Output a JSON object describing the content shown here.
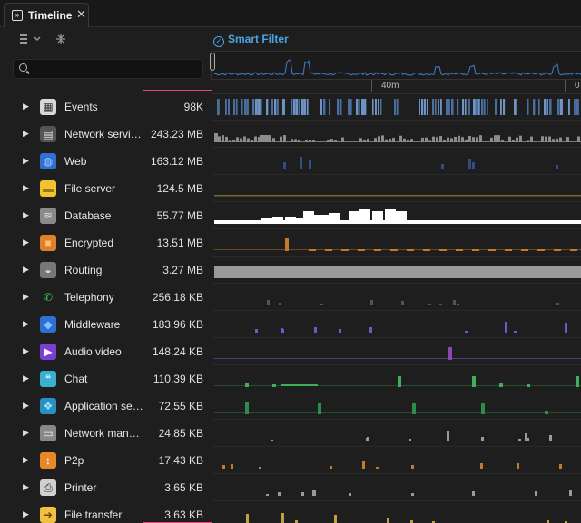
{
  "tab": {
    "title": "Timeline",
    "close_glyph": "✕",
    "icon_glyph": "»"
  },
  "toolbar": {
    "smart_filter_label": "Smart Filter",
    "list_options_icon": "list-view-icon",
    "collapse_icon": "collapse-rows-icon"
  },
  "search": {
    "placeholder": "",
    "value": ""
  },
  "overview": {
    "accent": "#3e7fd0",
    "ticks": [
      "40m",
      "0"
    ]
  },
  "colors": {
    "highlight": "#e0457b",
    "accent": "#4da3e0"
  },
  "rows": [
    {
      "label": "Events",
      "size": "98K",
      "icon": "calendar-icon",
      "glyph": "▦",
      "icon_bg": "#d8d8d8",
      "icon_fg": "#333",
      "track_color": "#4a6f9e",
      "track": "dense"
    },
    {
      "label": "Network services",
      "size": "243.23 MB",
      "icon": "network-services-icon",
      "glyph": "▤",
      "icon_bg": "#555",
      "icon_fg": "#ddd",
      "track_color": "#8c8c8c",
      "track": "gray"
    },
    {
      "label": "Web",
      "size": "163.12 MB",
      "icon": "globe-icon",
      "glyph": "◍",
      "icon_bg": "#2f6fd6",
      "icon_fg": "#9fd1ff",
      "track_color": "#2f4e86",
      "track": "bars"
    },
    {
      "label": "File server",
      "size": "124.5 MB",
      "icon": "folder-icon",
      "glyph": "▬",
      "icon_bg": "#f2c230",
      "icon_fg": "#a07610",
      "track_color": "#7a6632",
      "track": "line"
    },
    {
      "label": "Database",
      "size": "55.77 MB",
      "icon": "database-icon",
      "glyph": "≋",
      "icon_bg": "#8a8a8a",
      "icon_fg": "#e0e0e0",
      "track_color": "#ffffff",
      "track": "white"
    },
    {
      "label": "Encrypted",
      "size": "13.51 MB",
      "icon": "lock-icon",
      "glyph": "■",
      "icon_bg": "#e0802a",
      "icon_fg": "#ffbe6e",
      "track_color": "#c47a2c",
      "track": "dashes"
    },
    {
      "label": "Routing",
      "size": "3.27 MB",
      "icon": "router-icon",
      "glyph": "◒",
      "icon_bg": "#777",
      "icon_fg": "#ddd",
      "track_color": "#9a9a9a",
      "track": "solid"
    },
    {
      "label": "Telephony",
      "size": "256.18 KB",
      "icon": "phone-icon",
      "glyph": "✆",
      "icon_bg": "#1e1e1e",
      "icon_fg": "#3cc95a",
      "track_color": "#555555",
      "track": "sparse"
    },
    {
      "label": "Middleware",
      "size": "183.96 KB",
      "icon": "layers-icon",
      "glyph": "◆",
      "icon_bg": "#2e6fd0",
      "icon_fg": "#7ec0ff",
      "track_color": "#7a52c9",
      "track": "sparse"
    },
    {
      "label": "Audio video",
      "size": "148.24 KB",
      "icon": "video-play-icon",
      "glyph": "▶",
      "icon_bg": "#7e3ed6",
      "icon_fg": "#ffffff",
      "track_color": "#8a48b0",
      "track": "purple"
    },
    {
      "label": "Chat",
      "size": "110.39 KB",
      "icon": "chat-bubbles-icon",
      "glyph": "❝",
      "icon_bg": "#3ab0d0",
      "icon_fg": "#c8f0ff",
      "track_color": "#3fae5a",
      "track": "green"
    },
    {
      "label": "Application services",
      "size": "72.55 KB",
      "icon": "cubes-icon",
      "glyph": "❖",
      "icon_bg": "#2c8fc2",
      "icon_fg": "#9ee0ff",
      "track_color": "#2f8a4e",
      "track": "green2"
    },
    {
      "label": "Network management",
      "size": "24.85 KB",
      "icon": "network-management-icon",
      "glyph": "▭",
      "icon_bg": "#888",
      "icon_fg": "#eee",
      "track_color": "#9a9a9a",
      "track": "sparse"
    },
    {
      "label": "P2p",
      "size": "17.43 KB",
      "icon": "p2p-arrows-icon",
      "glyph": "↕",
      "icon_bg": "#e8862a",
      "icon_fg": "#ffffff",
      "track_color": "#c47a2c",
      "track": "sparse"
    },
    {
      "label": "Printer",
      "size": "3.65 KB",
      "icon": "printer-icon",
      "glyph": "⎙",
      "icon_bg": "#d0d0d0",
      "icon_fg": "#333",
      "track_color": "#9a9a9a",
      "track": "sparse"
    },
    {
      "label": "File transfer",
      "size": "3.63 KB",
      "icon": "file-transfer-icon",
      "glyph": "➜",
      "icon_bg": "#f0c040",
      "icon_fg": "#6a4a00",
      "track_color": "#c0a040",
      "track": "sparse"
    }
  ]
}
